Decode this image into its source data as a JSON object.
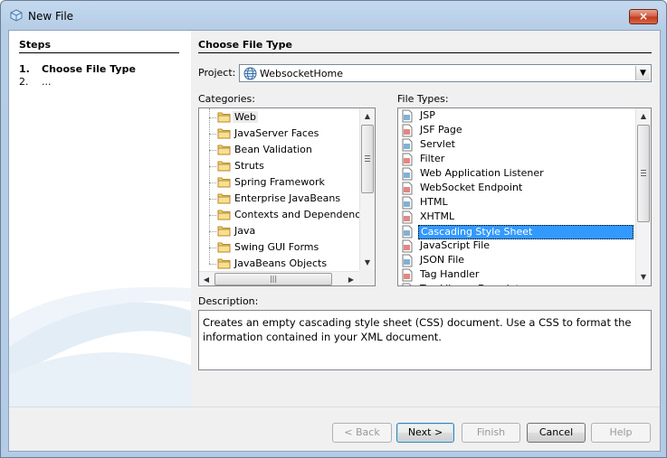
{
  "window": {
    "title": "New File",
    "close_glyph": "×"
  },
  "steps": {
    "heading": "Steps",
    "items": [
      {
        "num": "1.",
        "label": "Choose File Type"
      },
      {
        "num": "2.",
        "label": "..."
      }
    ]
  },
  "main": {
    "heading": "Choose File Type",
    "project_label": "Project:",
    "project_value": "WebsocketHome",
    "categories_label": "Categories:",
    "filetypes_label": "File Types:",
    "description_label": "Description:",
    "description_text": "Creates an empty cascading style sheet (CSS) document. Use a CSS to format the information contained in your XML document."
  },
  "categories": [
    "Web",
    "JavaServer Faces",
    "Bean Validation",
    "Struts",
    "Spring Framework",
    "Enterprise JavaBeans",
    "Contexts and Dependency Inje",
    "Java",
    "Swing GUI Forms",
    "JavaBeans Objects"
  ],
  "selected_category": "Web",
  "file_types": [
    {
      "label": "JSP",
      "icon": "jsp-file-icon"
    },
    {
      "label": "JSF Page",
      "icon": "jsf-file-icon"
    },
    {
      "label": "Servlet",
      "icon": "servlet-icon"
    },
    {
      "label": "Filter",
      "icon": "filter-icon"
    },
    {
      "label": "Web Application Listener",
      "icon": "listener-icon"
    },
    {
      "label": "WebSocket Endpoint",
      "icon": "websocket-icon"
    },
    {
      "label": "HTML",
      "icon": "html-file-icon"
    },
    {
      "label": "XHTML",
      "icon": "xhtml-file-icon"
    },
    {
      "label": "Cascading Style Sheet",
      "icon": "css-file-icon"
    },
    {
      "label": "JavaScript File",
      "icon": "js-file-icon"
    },
    {
      "label": "JSON File",
      "icon": "json-file-icon"
    },
    {
      "label": "Tag Handler",
      "icon": "tag-handler-icon"
    },
    {
      "label": "Tag Library Descriptor",
      "icon": "tld-file-icon"
    }
  ],
  "selected_file_type": "Cascading Style Sheet",
  "buttons": {
    "back": "< Back",
    "next": "Next >",
    "finish": "Finish",
    "cancel": "Cancel",
    "help": "Help"
  },
  "colors": {
    "selection": "#3399ff",
    "title_bar": "#b9d1ea"
  }
}
